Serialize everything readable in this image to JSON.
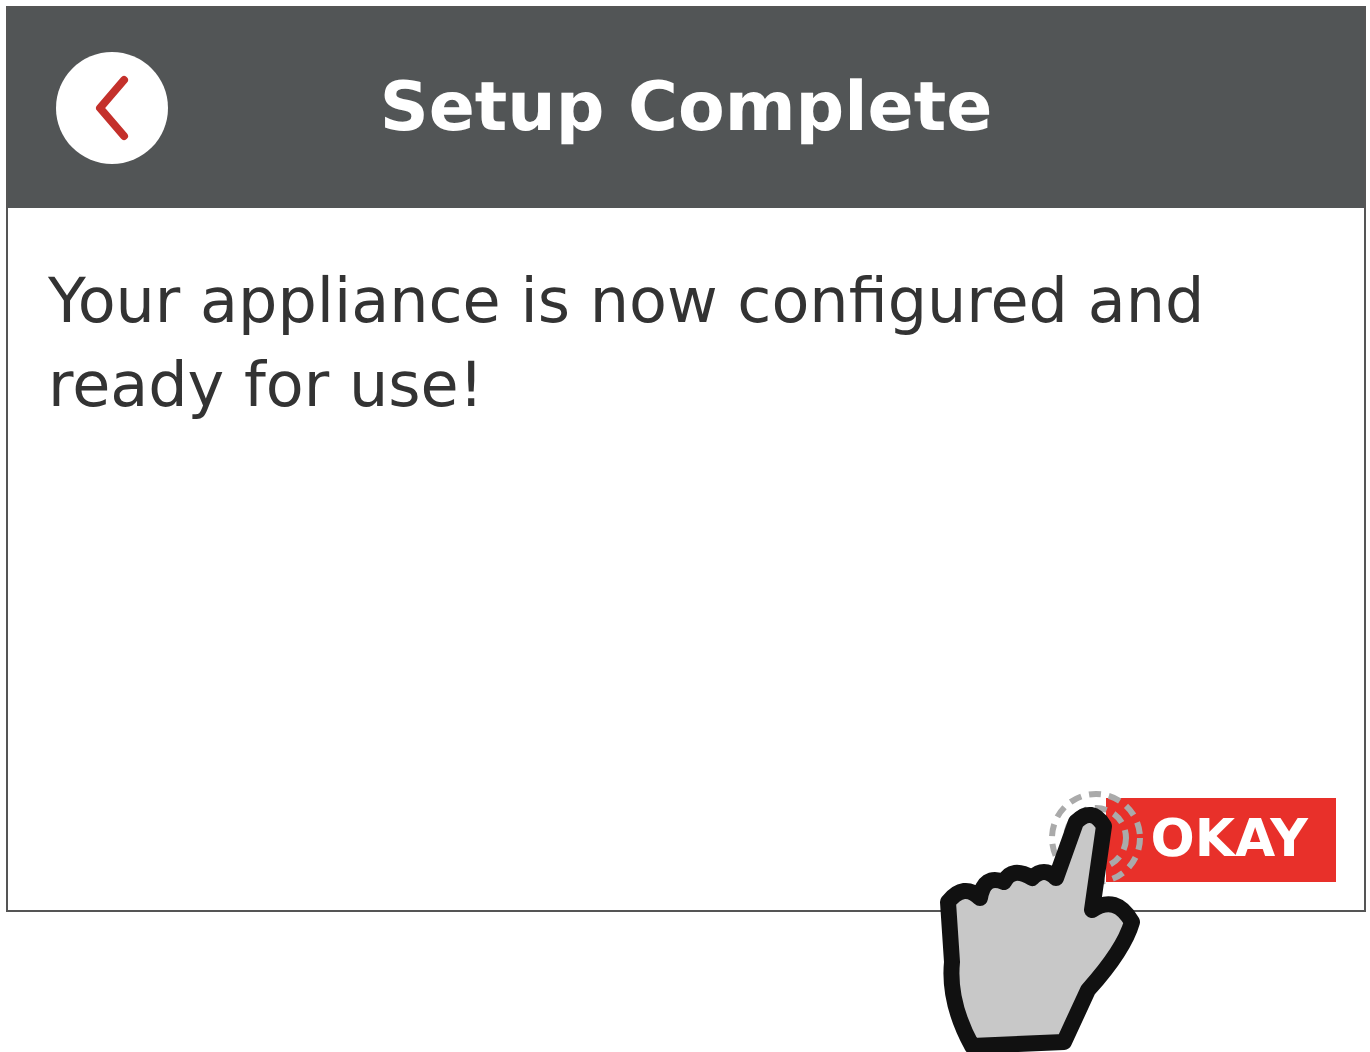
{
  "header": {
    "title": "Setup Complete"
  },
  "message": "Your appliance is now configured and ready for use!",
  "buttons": [
    {
      "label": "OKAY"
    }
  ]
}
